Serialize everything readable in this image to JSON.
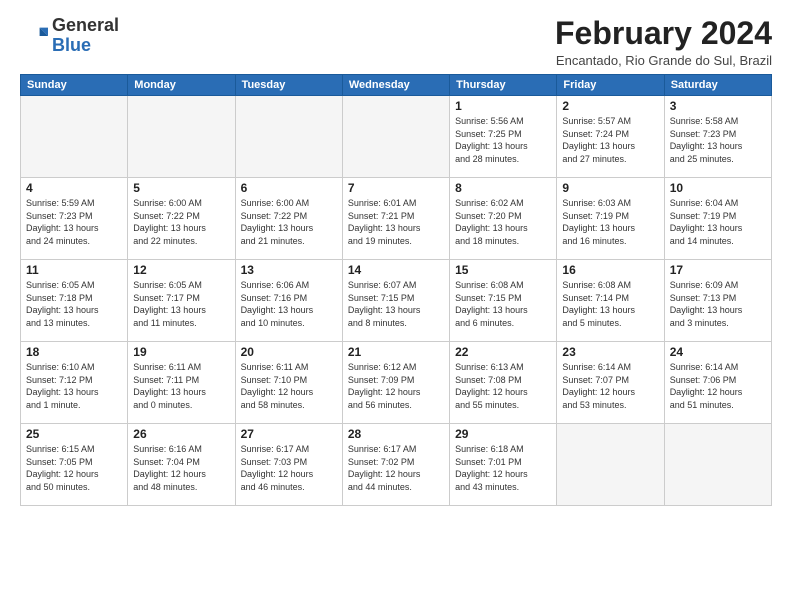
{
  "logo": {
    "general": "General",
    "blue": "Blue"
  },
  "title": "February 2024",
  "subtitle": "Encantado, Rio Grande do Sul, Brazil",
  "days_of_week": [
    "Sunday",
    "Monday",
    "Tuesday",
    "Wednesday",
    "Thursday",
    "Friday",
    "Saturday"
  ],
  "weeks": [
    [
      {
        "day": "",
        "info": ""
      },
      {
        "day": "",
        "info": ""
      },
      {
        "day": "",
        "info": ""
      },
      {
        "day": "",
        "info": ""
      },
      {
        "day": "1",
        "info": "Sunrise: 5:56 AM\nSunset: 7:25 PM\nDaylight: 13 hours\nand 28 minutes."
      },
      {
        "day": "2",
        "info": "Sunrise: 5:57 AM\nSunset: 7:24 PM\nDaylight: 13 hours\nand 27 minutes."
      },
      {
        "day": "3",
        "info": "Sunrise: 5:58 AM\nSunset: 7:23 PM\nDaylight: 13 hours\nand 25 minutes."
      }
    ],
    [
      {
        "day": "4",
        "info": "Sunrise: 5:59 AM\nSunset: 7:23 PM\nDaylight: 13 hours\nand 24 minutes."
      },
      {
        "day": "5",
        "info": "Sunrise: 6:00 AM\nSunset: 7:22 PM\nDaylight: 13 hours\nand 22 minutes."
      },
      {
        "day": "6",
        "info": "Sunrise: 6:00 AM\nSunset: 7:22 PM\nDaylight: 13 hours\nand 21 minutes."
      },
      {
        "day": "7",
        "info": "Sunrise: 6:01 AM\nSunset: 7:21 PM\nDaylight: 13 hours\nand 19 minutes."
      },
      {
        "day": "8",
        "info": "Sunrise: 6:02 AM\nSunset: 7:20 PM\nDaylight: 13 hours\nand 18 minutes."
      },
      {
        "day": "9",
        "info": "Sunrise: 6:03 AM\nSunset: 7:19 PM\nDaylight: 13 hours\nand 16 minutes."
      },
      {
        "day": "10",
        "info": "Sunrise: 6:04 AM\nSunset: 7:19 PM\nDaylight: 13 hours\nand 14 minutes."
      }
    ],
    [
      {
        "day": "11",
        "info": "Sunrise: 6:05 AM\nSunset: 7:18 PM\nDaylight: 13 hours\nand 13 minutes."
      },
      {
        "day": "12",
        "info": "Sunrise: 6:05 AM\nSunset: 7:17 PM\nDaylight: 13 hours\nand 11 minutes."
      },
      {
        "day": "13",
        "info": "Sunrise: 6:06 AM\nSunset: 7:16 PM\nDaylight: 13 hours\nand 10 minutes."
      },
      {
        "day": "14",
        "info": "Sunrise: 6:07 AM\nSunset: 7:15 PM\nDaylight: 13 hours\nand 8 minutes."
      },
      {
        "day": "15",
        "info": "Sunrise: 6:08 AM\nSunset: 7:15 PM\nDaylight: 13 hours\nand 6 minutes."
      },
      {
        "day": "16",
        "info": "Sunrise: 6:08 AM\nSunset: 7:14 PM\nDaylight: 13 hours\nand 5 minutes."
      },
      {
        "day": "17",
        "info": "Sunrise: 6:09 AM\nSunset: 7:13 PM\nDaylight: 13 hours\nand 3 minutes."
      }
    ],
    [
      {
        "day": "18",
        "info": "Sunrise: 6:10 AM\nSunset: 7:12 PM\nDaylight: 13 hours\nand 1 minute."
      },
      {
        "day": "19",
        "info": "Sunrise: 6:11 AM\nSunset: 7:11 PM\nDaylight: 13 hours\nand 0 minutes."
      },
      {
        "day": "20",
        "info": "Sunrise: 6:11 AM\nSunset: 7:10 PM\nDaylight: 12 hours\nand 58 minutes."
      },
      {
        "day": "21",
        "info": "Sunrise: 6:12 AM\nSunset: 7:09 PM\nDaylight: 12 hours\nand 56 minutes."
      },
      {
        "day": "22",
        "info": "Sunrise: 6:13 AM\nSunset: 7:08 PM\nDaylight: 12 hours\nand 55 minutes."
      },
      {
        "day": "23",
        "info": "Sunrise: 6:14 AM\nSunset: 7:07 PM\nDaylight: 12 hours\nand 53 minutes."
      },
      {
        "day": "24",
        "info": "Sunrise: 6:14 AM\nSunset: 7:06 PM\nDaylight: 12 hours\nand 51 minutes."
      }
    ],
    [
      {
        "day": "25",
        "info": "Sunrise: 6:15 AM\nSunset: 7:05 PM\nDaylight: 12 hours\nand 50 minutes."
      },
      {
        "day": "26",
        "info": "Sunrise: 6:16 AM\nSunset: 7:04 PM\nDaylight: 12 hours\nand 48 minutes."
      },
      {
        "day": "27",
        "info": "Sunrise: 6:17 AM\nSunset: 7:03 PM\nDaylight: 12 hours\nand 46 minutes."
      },
      {
        "day": "28",
        "info": "Sunrise: 6:17 AM\nSunset: 7:02 PM\nDaylight: 12 hours\nand 44 minutes."
      },
      {
        "day": "29",
        "info": "Sunrise: 6:18 AM\nSunset: 7:01 PM\nDaylight: 12 hours\nand 43 minutes."
      },
      {
        "day": "",
        "info": ""
      },
      {
        "day": "",
        "info": ""
      }
    ]
  ]
}
